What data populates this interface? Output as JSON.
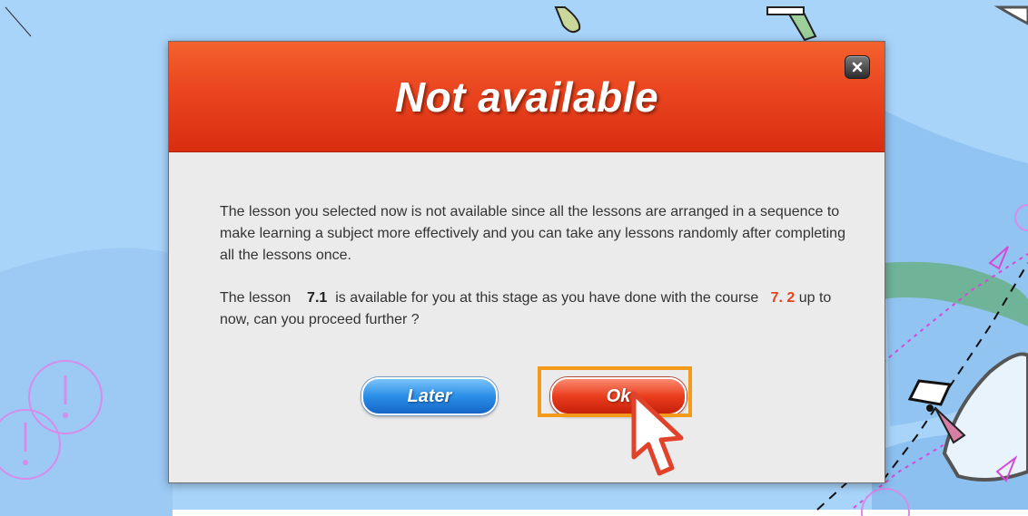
{
  "dialog": {
    "title": "Not available",
    "close_icon": "close-icon",
    "message_paragraph_1": "The lesson you selected now is not available since all the lessons are arranged in a sequence to make learning a subject more effectively and you can take any lessons randomly after completing all the lessons once.",
    "message_paragraph_2": {
      "part1": "The lesson",
      "available_lesson": "7.1",
      "part2": "is available for you at this stage as you have done with the course",
      "done_course": "7. 2",
      "part3": "up to now, can you proceed further ?"
    },
    "buttons": {
      "later_label": "Later",
      "ok_label": "Ok"
    }
  },
  "colors": {
    "header_red": "#ea4520",
    "later_blue": "#2a8ee8",
    "ok_red": "#ea3d1e",
    "highlight_orange": "#f39a1a",
    "map_sea": "#a8d4fa",
    "map_shallow": "#80b8ee",
    "map_green": "#6fb399"
  },
  "annotations": {
    "highlight": "highlight-box",
    "pointer": "mouse-cursor-icon"
  }
}
